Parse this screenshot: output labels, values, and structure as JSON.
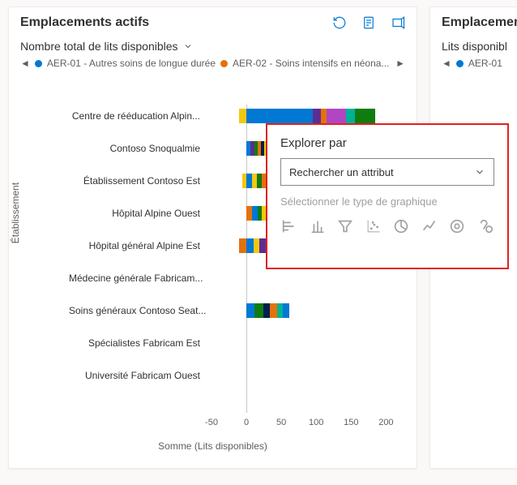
{
  "card_main": {
    "title": "Emplacements actifs",
    "dropdown_label": "Nombre total de lits disponibles",
    "legend": [
      {
        "color": "#0078d4",
        "label": "AER-01 - Autres soins de longue durée"
      },
      {
        "color": "#e3720b",
        "label": "AER-02 - Soins intensifs en néona..."
      }
    ],
    "xlabel": "Somme (Lits disponibles)",
    "ylabel": "Établissement",
    "xticks": [
      "-50",
      "0",
      "50",
      "100",
      "150",
      "200"
    ]
  },
  "card_side": {
    "title": "Emplacement",
    "dropdown_label": "Lits disponibl",
    "legend": [
      {
        "color": "#0078d4",
        "label": "AER-01"
      }
    ]
  },
  "popover": {
    "title": "Explorer par",
    "search_placeholder": "Rechercher un attribut",
    "subtitle": "Sélectionner le type de graphique"
  },
  "chart_data": {
    "type": "bar",
    "xlabel": "Somme (Lits disponibles)",
    "ylabel": "Établissement",
    "xlim": [
      -50,
      210
    ],
    "categories": [
      "Centre de rééducation Alpin...",
      "Contoso Snoqualmie",
      "Établissement Contoso Est",
      "Hôpital Alpine Ouest",
      "Hôpital général Alpine Est",
      "Médecine générale Fabricam...",
      "Soins généraux Contoso Seat...",
      "Spécialistes Fabricam Est",
      "Université Fabricam Ouest"
    ],
    "rows": [
      {
        "neg": [
          {
            "c": "#f2c80f",
            "v": 10
          }
        ],
        "pos": [
          {
            "c": "#0078d4",
            "v": 95
          },
          {
            "c": "#5c2e91",
            "v": 12
          },
          {
            "c": "#e3720b",
            "v": 8
          },
          {
            "c": "#b146c2",
            "v": 28
          },
          {
            "c": "#00b294",
            "v": 12
          },
          {
            "c": "#107c10",
            "v": 30
          }
        ]
      },
      {
        "neg": [],
        "pos": [
          {
            "c": "#0078d4",
            "v": 6
          },
          {
            "c": "#5c2e91",
            "v": 5
          },
          {
            "c": "#107c10",
            "v": 5
          },
          {
            "c": "#e3720b",
            "v": 5
          },
          {
            "c": "#002050",
            "v": 5
          },
          {
            "c": "#f2c80f",
            "v": 5
          }
        ]
      },
      {
        "neg": [
          {
            "c": "#f2c80f",
            "v": 6
          }
        ],
        "pos": [
          {
            "c": "#0078d4",
            "v": 8
          },
          {
            "c": "#f2c80f",
            "v": 7
          },
          {
            "c": "#107c10",
            "v": 7
          },
          {
            "c": "#e3720b",
            "v": 6
          },
          {
            "c": "#5c2e91",
            "v": 6
          },
          {
            "c": "#00b294",
            "v": 6
          },
          {
            "c": "#0078d4",
            "v": 8
          }
        ]
      },
      {
        "neg": [],
        "pos": [
          {
            "c": "#e3720b",
            "v": 8
          },
          {
            "c": "#0078d4",
            "v": 8
          },
          {
            "c": "#107c10",
            "v": 6
          },
          {
            "c": "#f2c80f",
            "v": 6
          },
          {
            "c": "#5c2e91",
            "v": 6
          },
          {
            "c": "#002050",
            "v": 6
          },
          {
            "c": "#00b294",
            "v": 6
          }
        ]
      },
      {
        "neg": [
          {
            "c": "#e3720b",
            "v": 10
          }
        ],
        "pos": [
          {
            "c": "#0078d4",
            "v": 10
          },
          {
            "c": "#f2c80f",
            "v": 8
          },
          {
            "c": "#5c2e91",
            "v": 12
          },
          {
            "c": "#107c10",
            "v": 8
          },
          {
            "c": "#002050",
            "v": 10
          }
        ]
      },
      {
        "neg": [],
        "pos": []
      },
      {
        "neg": [],
        "pos": [
          {
            "c": "#0078d4",
            "v": 12
          },
          {
            "c": "#107c10",
            "v": 12
          },
          {
            "c": "#002050",
            "v": 10
          },
          {
            "c": "#e3720b",
            "v": 10
          },
          {
            "c": "#00b294",
            "v": 8
          },
          {
            "c": "#0078d4",
            "v": 10
          }
        ]
      },
      {
        "neg": [],
        "pos": []
      },
      {
        "neg": [],
        "pos": []
      }
    ]
  }
}
